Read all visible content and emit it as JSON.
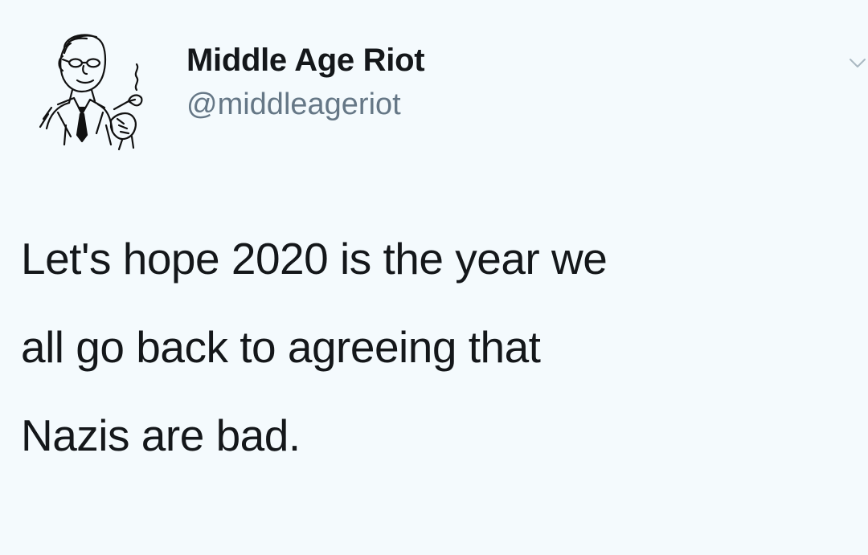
{
  "tweet": {
    "author": {
      "display_name": "Middle Age Riot",
      "handle": "@middleageriot",
      "avatar_icon": "pipe-smoking-man-avatar-icon"
    },
    "menu_icon": "chevron-down-icon",
    "text": "Let's hope 2020 is the year we\nall go back to agreeing that\nNazis are bad."
  },
  "colors": {
    "background": "#f4fafd",
    "text": "#14171a",
    "handle": "#657786",
    "caret": "#aab8c2"
  }
}
